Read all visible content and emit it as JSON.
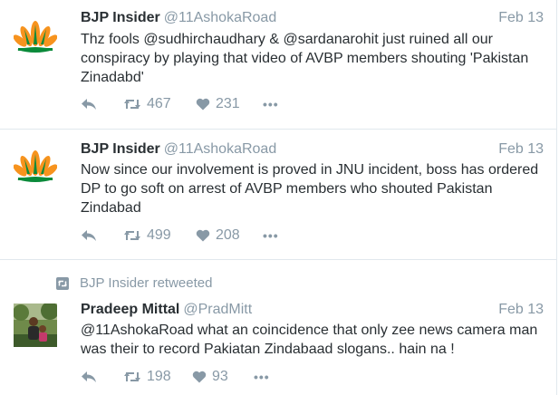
{
  "tweets": [
    {
      "name": "BJP Insider",
      "handle": "@11AshokaRoad",
      "time": "Feb 13",
      "text": "Thz fools @sudhirchaudhary & @sardanarohit just ruined all our conspiracy by playing that video of AVBP members shouting 'Pakistan Zinadabd'",
      "retweets": "467",
      "likes": "231",
      "avatar": "bjp-lotus-logo"
    },
    {
      "name": "BJP Insider",
      "handle": "@11AshokaRoad",
      "time": "Feb 13",
      "text": "Now since our involvement is proved in JNU incident, boss has ordered DP to go soft on arrest of AVBP members who shouted Pakistan Zindabad",
      "retweets": "499",
      "likes": "208",
      "avatar": "bjp-lotus-logo"
    },
    {
      "context": "BJP Insider retweeted",
      "name": "Pradeep Mittal",
      "handle": "@PradMitt",
      "time": "Feb 13",
      "text": "@11AshokaRoad what an coincidence that only zee news camera man was their to record Pakiatan Zindabaad slogans.. hain na !",
      "retweets": "198",
      "likes": "93",
      "avatar": "user-photo"
    }
  ],
  "icons": {
    "reply": "reply-icon",
    "retweet": "retweet-icon",
    "like": "heart-icon",
    "more": "more-icon"
  },
  "more_glyph": "•••",
  "colors": {
    "text": "#292f33",
    "muted": "#8899a6",
    "divider": "#e1e8ed",
    "lotus_orange": "#f7931e",
    "lotus_green": "#0a8a3a"
  }
}
